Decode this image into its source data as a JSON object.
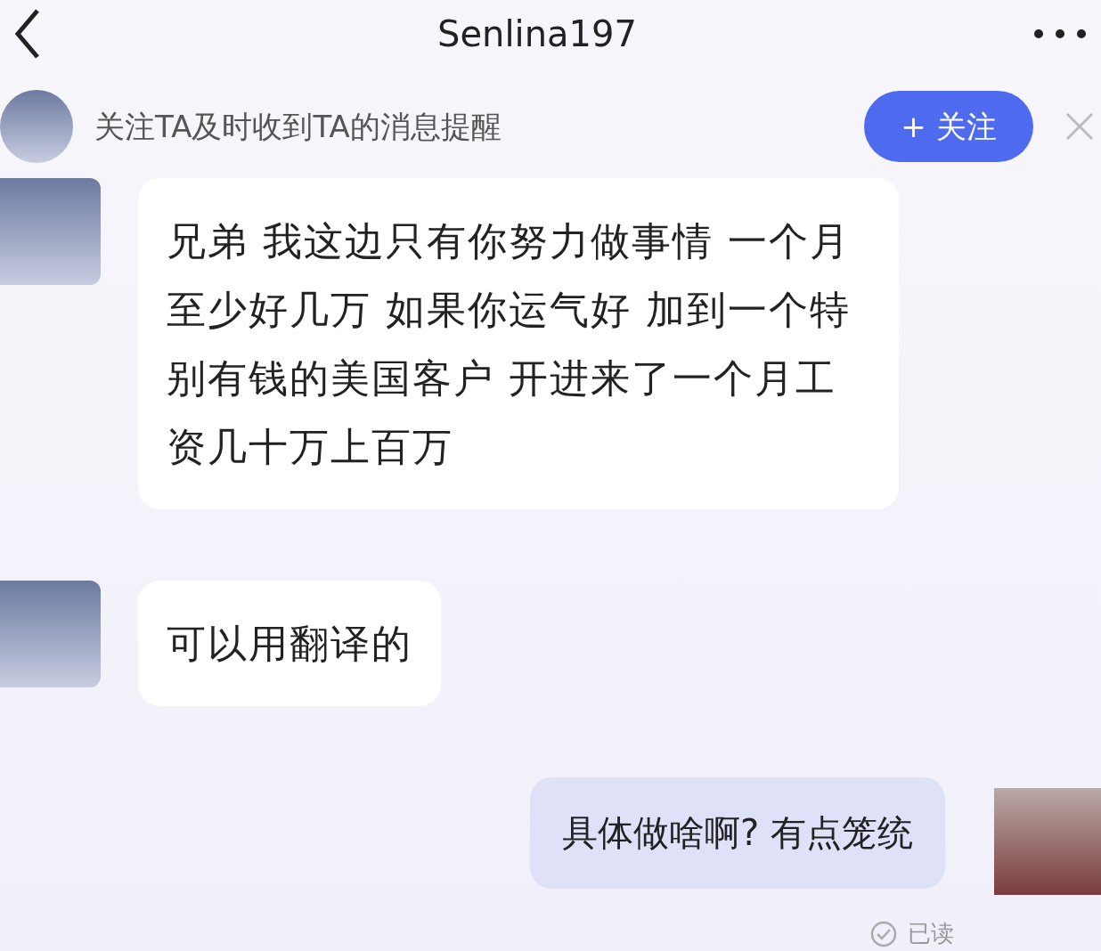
{
  "header": {
    "title": "Senlina197"
  },
  "follow_bar": {
    "text": "关注TA及时收到TA的消息提醒",
    "button": "+ 关注"
  },
  "messages": [
    {
      "kind": "received",
      "text": "兄弟 我这边只有你努力做事情 一个月至少好几万 如果你运气好 加到一个特别有钱的美国客户 开进来了一个月工资几十万上百万"
    },
    {
      "kind": "received",
      "text": "可以用翻译的"
    },
    {
      "kind": "sent",
      "text": "具体做啥啊? 有点笼统"
    }
  ],
  "read_status": "已读"
}
